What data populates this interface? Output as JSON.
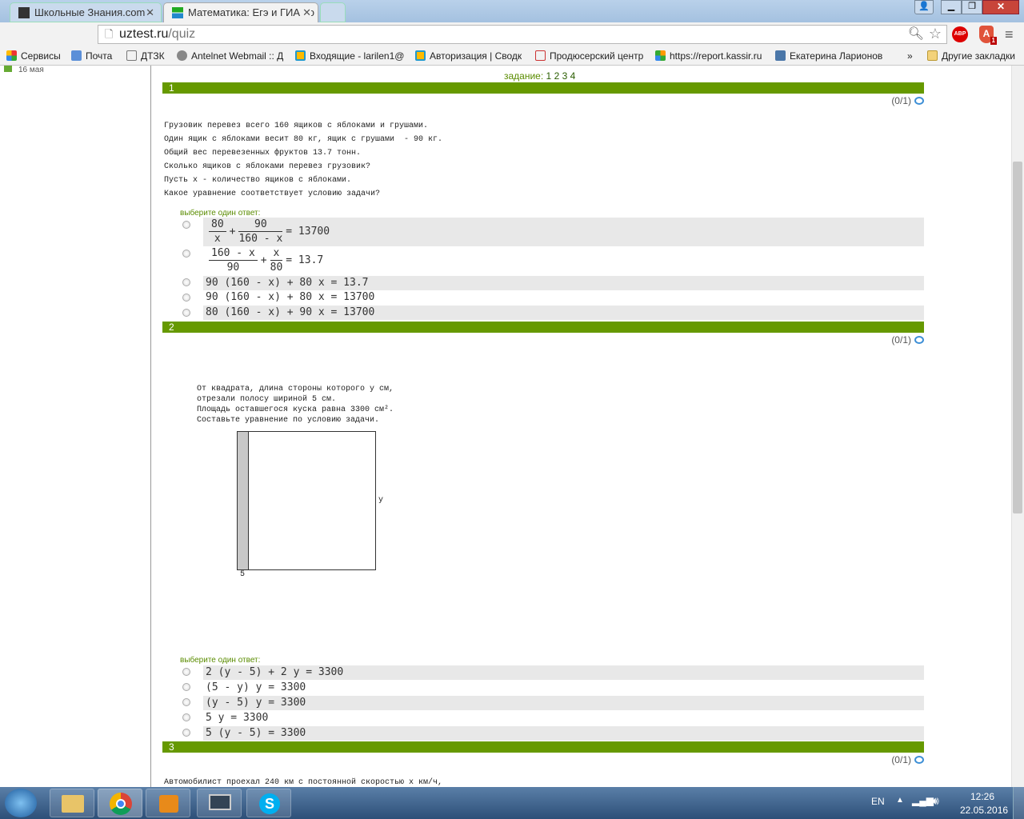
{
  "browser": {
    "tabs": [
      {
        "label": "Школьные Знания.com -",
        "active": false
      },
      {
        "label": "Математика: Егэ и ГИА по",
        "active": true
      }
    ],
    "url_host": "uztest.ru",
    "url_path": "/quiz",
    "bookmarks": [
      "Сервисы",
      "Почта",
      "ДТЗК",
      "Antelnet Webmail :: Д",
      "Входящие - larilen1@",
      "Авторизация | Сводк",
      "Продюсерский центр",
      "https://report.kassir.ru",
      "Екатерина Ларионов"
    ],
    "more": "»",
    "other_bookmarks": "Другие закладки",
    "ext_abp": "ABP",
    "ext_badge": "1"
  },
  "sidebar": {
    "date": "16 мая"
  },
  "quiz": {
    "task_label": "задание:",
    "task_links": [
      "1",
      "2",
      "3",
      "4"
    ],
    "pick_label": "выберите один ответ:",
    "q1": {
      "num": "1",
      "score": "(0/1)",
      "text": [
        "Грузовик перевез всего 160 ящиков с яблоками и грушами.",
        "Один ящик с яблоками весит 80 кг, ящик с грушами  - 90 кг.",
        "Общий вес перевезенных фруктов 13.7 тонн.",
        "Сколько ящиков с яблоками перевез грузовик?",
        "Пусть x - количество ящиков с яблоками.",
        "Какое уравнение соответствует условию задачи?"
      ],
      "opt1": {
        "n1": "80",
        "d1": "x",
        "n2": "90",
        "d2": "160 - x",
        "rhs": "= 13700"
      },
      "opt2": {
        "n1": "160 - x",
        "d1": "90",
        "n2": "x",
        "d2": "80",
        "rhs": "= 13.7"
      },
      "options": [
        "90 (160 - x) + 80 x = 13.7",
        "90 (160 - x) + 80 x = 13700",
        "80 (160 - x) + 90 x = 13700"
      ]
    },
    "q2": {
      "num": "2",
      "score": "(0/1)",
      "text": [
        "От квадрата, длина стороны которого y см,",
        "отрезали полосу шириной 5 см.",
        "Площадь оставшегося куска равна 3300 см².",
        "Составьте уравнение по условию задачи."
      ],
      "fig_y": "y",
      "fig_5": "5",
      "options": [
        "2 (y - 5) + 2 y = 3300",
        "(5 - y) y = 3300",
        "(y - 5) y = 3300",
        "5 y = 3300",
        "5 (y - 5) = 3300"
      ]
    },
    "q3": {
      "num": "3",
      "score": "(0/1)",
      "text": "Автомобилист проехал 240 км с постоянной скоростью x км/ч,"
    }
  },
  "taskbar": {
    "lang": "EN",
    "time": "12:26",
    "date": "22.05.2016"
  }
}
